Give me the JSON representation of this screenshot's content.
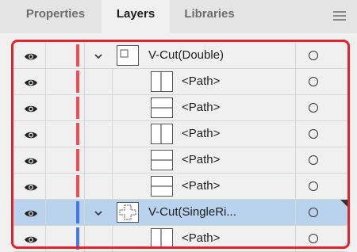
{
  "tabs": [
    {
      "label": "Properties",
      "active": false
    },
    {
      "label": "Layers",
      "active": true
    },
    {
      "label": "Libraries",
      "active": false
    }
  ],
  "panel_menu_icon": "hamburger-menu-icon",
  "layers": [
    {
      "name": "V-Cut(Double)",
      "type": "group",
      "level": 0,
      "expanded": true,
      "color": "#f04a55",
      "selected": false,
      "thumb": "square-small"
    },
    {
      "name": "<Path>",
      "type": "path",
      "level": 1,
      "color": "#f04a55",
      "selected": false,
      "thumb": "vertical-line"
    },
    {
      "name": "<Path>",
      "type": "path",
      "level": 1,
      "color": "#f04a55",
      "selected": false,
      "thumb": "horizontal-line"
    },
    {
      "name": "<Path>",
      "type": "path",
      "level": 1,
      "color": "#f04a55",
      "selected": false,
      "thumb": "vertical-line"
    },
    {
      "name": "<Path>",
      "type": "path",
      "level": 1,
      "color": "#f04a55",
      "selected": false,
      "thumb": "horizontal-line"
    },
    {
      "name": "<Path>",
      "type": "path",
      "level": 1,
      "color": "#f04a55",
      "selected": false,
      "thumb": "horizontal-line"
    },
    {
      "name": "V-Cut(SingleRi...",
      "type": "group",
      "level": 0,
      "expanded": true,
      "color": "#3f7be6",
      "selected": true,
      "thumb": "cross"
    },
    {
      "name": "<Path>",
      "type": "path",
      "level": 1,
      "color": "#3f7be6",
      "selected": false,
      "thumb": "vertical-line"
    }
  ],
  "colors": {
    "highlight_border": "#e0232d",
    "selection": "#b9d2ee"
  }
}
